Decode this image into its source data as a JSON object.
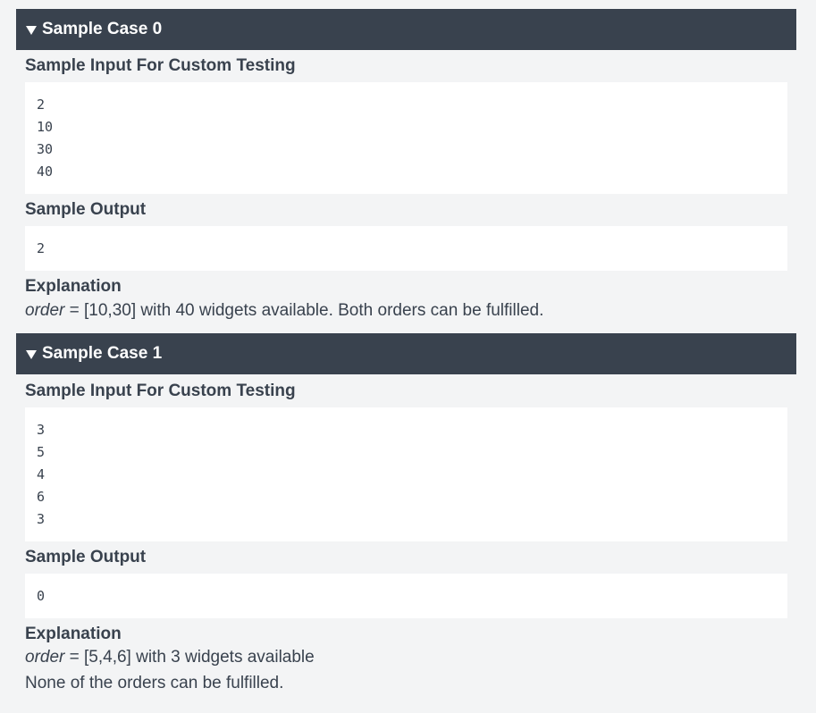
{
  "cases": [
    {
      "header": "Sample Case 0",
      "input_title": "Sample Input For Custom Testing",
      "input_lines": [
        "2",
        "10",
        "30",
        "40"
      ],
      "output_title": "Sample Output",
      "output_lines": [
        "2"
      ],
      "explanation_title": "Explanation",
      "explanation_lines": [
        {
          "italic": "order",
          "rest": " = [10,30] with 40 widgets available. Both orders can be fulfilled."
        }
      ]
    },
    {
      "header": "Sample Case 1",
      "input_title": "Sample Input For Custom Testing",
      "input_lines": [
        "3",
        "5",
        "4",
        "6",
        "3"
      ],
      "output_title": "Sample Output",
      "output_lines": [
        "0"
      ],
      "explanation_title": "Explanation",
      "explanation_lines": [
        {
          "italic": "order",
          "rest": " = [5,4,6] with 3 widgets available"
        },
        {
          "italic": "",
          "rest": "None of the orders can be fulfilled."
        }
      ]
    }
  ],
  "icons": {
    "caret": "caret-down-icon"
  },
  "colors": {
    "header_bg": "#39424e",
    "page_bg": "#f3f4f5",
    "box_bg": "#ffffff",
    "text": "#39424e"
  }
}
